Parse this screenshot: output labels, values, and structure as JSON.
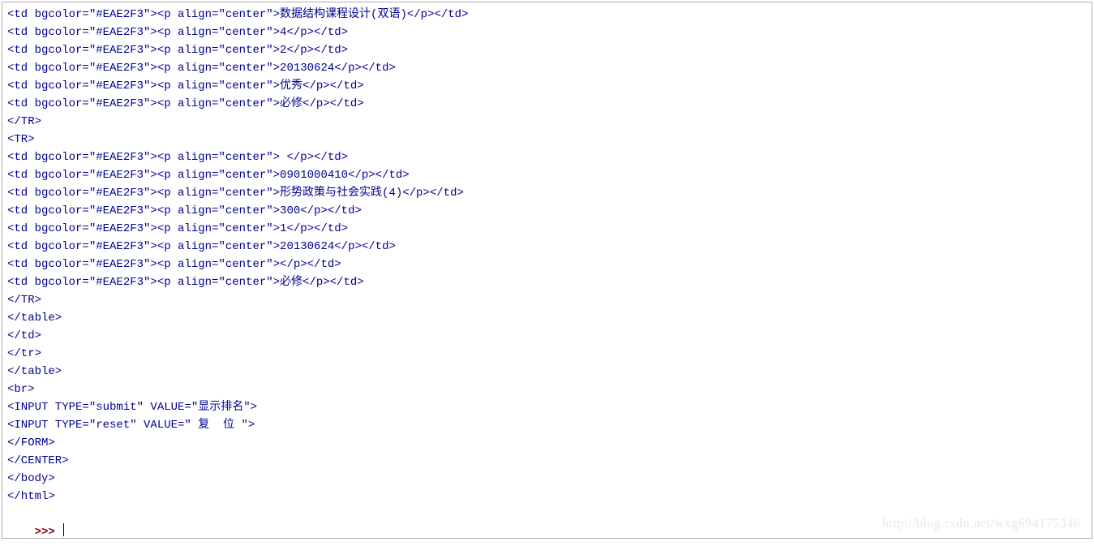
{
  "lines": {
    "l01": "<td bgcolor=\"#EAE2F3\"><p align=\"center\">数据结构课程设计(双语)</p></td>",
    "l02": "<td bgcolor=\"#EAE2F3\"><p align=\"center\">4</p></td>",
    "l03": "<td bgcolor=\"#EAE2F3\"><p align=\"center\">2</p></td>",
    "l04": "<td bgcolor=\"#EAE2F3\"><p align=\"center\">20130624</p></td>",
    "l05": "<td bgcolor=\"#EAE2F3\"><p align=\"center\">优秀</p></td>",
    "l06": "<td bgcolor=\"#EAE2F3\"><p align=\"center\">必修</p></td>",
    "l07": "</TR>",
    "l08": "<TR>",
    "l09": "<td bgcolor=\"#EAE2F3\"><p align=\"center\"> </p></td>",
    "l10": "<td bgcolor=\"#EAE2F3\"><p align=\"center\">0901000410</p></td>",
    "l11": "<td bgcolor=\"#EAE2F3\"><p align=\"center\">形势政策与社会实践(4)</p></td>",
    "l12": "<td bgcolor=\"#EAE2F3\"><p align=\"center\">300</p></td>",
    "l13": "<td bgcolor=\"#EAE2F3\"><p align=\"center\">1</p></td>",
    "l14": "<td bgcolor=\"#EAE2F3\"><p align=\"center\">20130624</p></td>",
    "l15": "<td bgcolor=\"#EAE2F3\"><p align=\"center\"></p></td>",
    "l16": "<td bgcolor=\"#EAE2F3\"><p align=\"center\">必修</p></td>",
    "l17": "</TR>",
    "l18": "</table>",
    "l19": "</td>",
    "l20": "</tr>",
    "l21": "</table>",
    "l22": "<br>",
    "l23": "<INPUT TYPE=\"submit\" VALUE=\"显示排名\">",
    "l24": "<INPUT TYPE=\"reset\" VALUE=\" 复  位 \">",
    "l25": "</FORM>",
    "l26": "</CENTER>",
    "l27": "</body>",
    "l28": "</html>"
  },
  "prompt": ">>> ",
  "watermark": "http://blog.csdn.net/wxg694175346"
}
